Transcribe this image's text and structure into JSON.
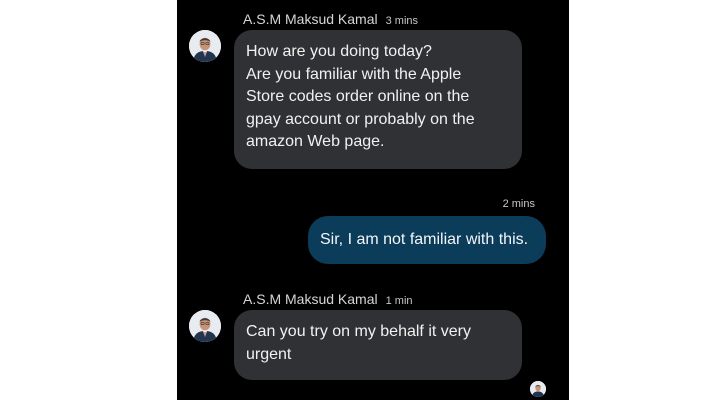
{
  "messages": [
    {
      "sender": "A.S.M Maksud Kamal",
      "time": "3 mins",
      "lines": [
        "How are you doing today?",
        "Are you familiar with the Apple",
        "Store codes order online on the",
        "gpay account or probably on the",
        "amazon Web page."
      ]
    },
    {
      "time": "2 mins",
      "text": "Sir, I am not familiar with this."
    },
    {
      "sender": "A.S.M Maksud Kamal",
      "time": "1 min",
      "lines": [
        "Can you try on my behalf it very",
        "urgent"
      ]
    }
  ],
  "icons": {
    "avatar": "contact-avatar-icon",
    "read_receipt": "read-receipt-avatar-icon"
  },
  "colors": {
    "background": "#000000",
    "incoming_bubble": "#2f3134",
    "outgoing_bubble": "#0b3c59"
  }
}
